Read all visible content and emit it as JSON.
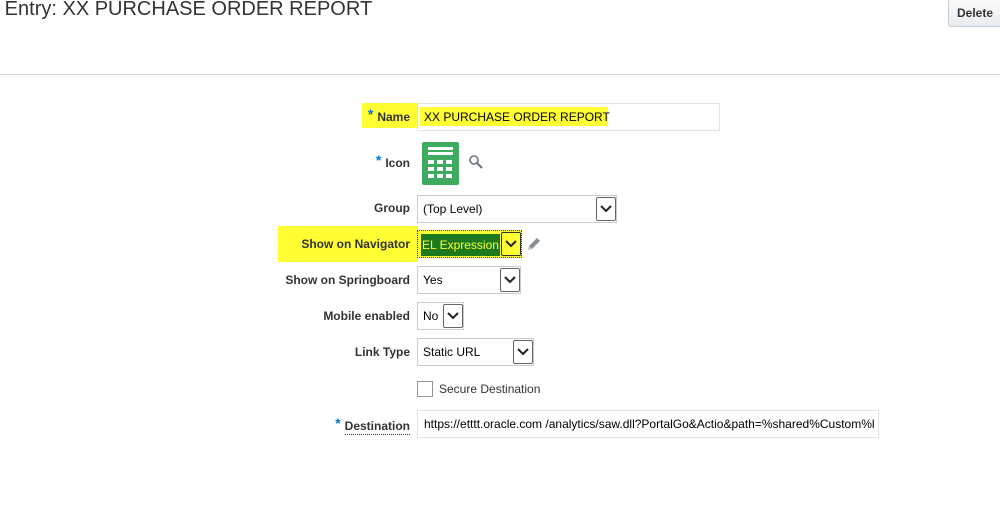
{
  "header": {
    "title": "e Entry: XX PURCHASE ORDER REPORT",
    "delete_label": "Delete"
  },
  "form": {
    "name": {
      "label": "Name",
      "value": "XX PURCHASE ORDER REPORT"
    },
    "icon": {
      "label": "Icon",
      "icon_name": "spreadsheet-icon",
      "search_icon": "search-icon"
    },
    "group": {
      "label": "Group",
      "value": "(Top Level)"
    },
    "show_on_navigator": {
      "label": "Show on Navigator",
      "value": "EL Expression",
      "edit_icon": "pencil-icon"
    },
    "show_on_springboard": {
      "label": "Show on Springboard",
      "value": "Yes"
    },
    "mobile_enabled": {
      "label": "Mobile enabled",
      "value": "No"
    },
    "link_type": {
      "label": "Link Type",
      "value": "Static URL"
    },
    "secure_destination": {
      "label": "Secure Destination",
      "checked": false
    },
    "destination": {
      "label": "Destination",
      "value": "https://etttt.oracle.com /analytics/saw.dll?PortalGo&Actio&path=%shared%Custom%l"
    }
  },
  "colors": {
    "highlight": "#ffff33",
    "required_asterisk": "#0572ce",
    "icon_green": "#3eab61",
    "selected_bg": "#1c7a1c"
  }
}
